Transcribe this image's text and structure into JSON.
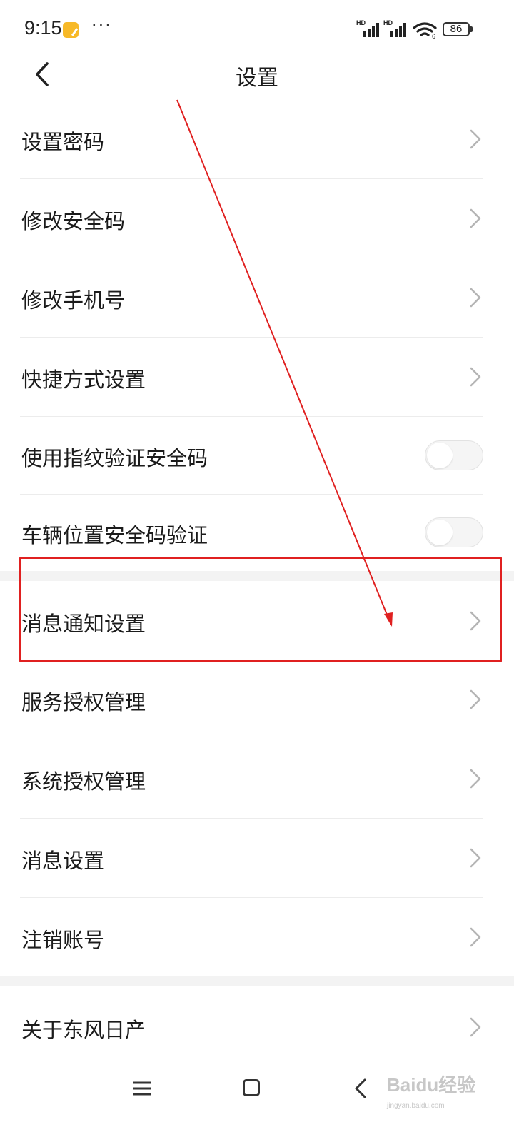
{
  "status_bar": {
    "time": "9:15",
    "notification_icon": "app-notification-icon",
    "more_indicator": "···",
    "sim1_label": "HD",
    "sim2_label": "HD",
    "battery_level": "86"
  },
  "header": {
    "title": "设置",
    "back_icon": "chevron-left-icon"
  },
  "settings": {
    "items": [
      {
        "label": "设置密码",
        "control": "chevron"
      },
      {
        "label": "修改安全码",
        "control": "chevron"
      },
      {
        "label": "修改手机号",
        "control": "chevron"
      },
      {
        "label": "快捷方式设置",
        "control": "chevron"
      },
      {
        "label": "使用指纹验证安全码",
        "control": "toggle",
        "on": false
      },
      {
        "label": "车辆位置安全码验证",
        "control": "toggle",
        "on": false
      },
      {
        "label": "消息通知设置",
        "control": "chevron",
        "highlighted": true
      },
      {
        "label": "服务授权管理",
        "control": "chevron"
      },
      {
        "label": "系统授权管理",
        "control": "chevron"
      },
      {
        "label": "消息设置",
        "control": "chevron"
      },
      {
        "label": "注销账号",
        "control": "chevron"
      },
      {
        "label": "关于东风日产",
        "control": "chevron"
      }
    ]
  },
  "annotation": {
    "color": "#e02020"
  },
  "nav_bar": {
    "menu_icon": "menu-icon",
    "home_icon": "home-square-icon",
    "back_icon": "back-triangle-icon"
  },
  "watermark": {
    "logo": "Baidu经验",
    "url": "jingyan.baidu.com"
  },
  "colors": {
    "text": "#1b1b1b",
    "chevron": "#b5b5b5",
    "divider": "#ececec",
    "section_gap": "#f3f3f3"
  }
}
